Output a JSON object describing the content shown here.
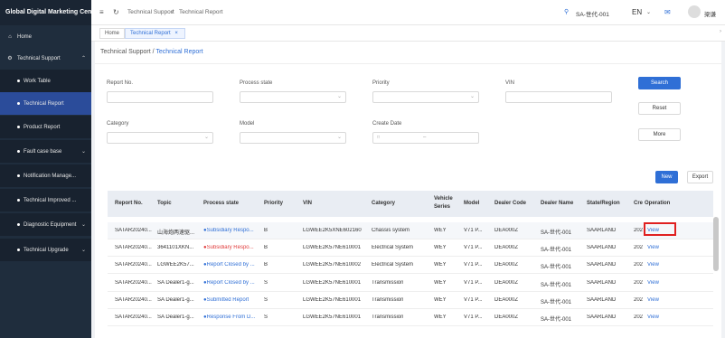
{
  "app": {
    "title": "Global Digital Marketing Center"
  },
  "sidebar": {
    "items": [
      {
        "label": "Home",
        "icon": "home-icon",
        "arrow": ""
      },
      {
        "label": "Technical Support",
        "icon": "gear-icon",
        "arrow": "⌃"
      },
      {
        "label": "Work Table",
        "arrow": ""
      },
      {
        "label": "Technical Report",
        "arrow": ""
      },
      {
        "label": "Product Report",
        "arrow": ""
      },
      {
        "label": "Fault case base",
        "arrow": "⌄"
      },
      {
        "label": "Notification Manage...",
        "arrow": ""
      },
      {
        "label": "Technical Improved ...",
        "arrow": ""
      },
      {
        "label": "Diagnostic Equipment",
        "arrow": "⌄"
      },
      {
        "label": "Technical Upgrade",
        "arrow": "⌄"
      }
    ]
  },
  "topbar": {
    "breadcrumb_1": "Technical Support",
    "separator": "/",
    "breadcrumb_2": "Technical Report",
    "account": "SA-世代-001",
    "language": "EN",
    "user": "梁谦"
  },
  "tabs": {
    "home": "Home",
    "active": "Technical Report",
    "close": "×"
  },
  "page": {
    "crumb_1": "Technical Support",
    "crumb_sep": "/",
    "crumb_2": "Technical Report"
  },
  "filters": {
    "report_no": "Report No.",
    "process_state": "Process state",
    "priority": "Priority",
    "vin": "VIN",
    "category": "Category",
    "model": "Model",
    "create_date": "Create Date",
    "date_sep": "–"
  },
  "buttons": {
    "search": "Search",
    "reset": "Reset",
    "more": "More",
    "new": "New",
    "export": "Export"
  },
  "table": {
    "headers": [
      "Report No.",
      "Topic",
      "Process state",
      "Priority",
      "VIN",
      "Category",
      "Vehicle Series",
      "Model",
      "Dealer Code",
      "Dealer Name",
      "State/Region",
      "Cre",
      "Operation"
    ],
    "header_vehicle_1": "Vehicle",
    "header_vehicle_2": "Series",
    "rows": [
      {
        "report": "SATAR20240...",
        "topic": "山海炮两速驱...",
        "state": "●Subsidiary Respo...",
        "state_color": "blue",
        "priority": "B",
        "vin": "LGWEE2K5XNE602160",
        "category": "Chassis system",
        "series": "WEY",
        "model": "V71 P...",
        "dealer_code": "DEA000Z",
        "dealer_name": "SA-世代-001",
        "region": "SAARLAND",
        "cre": "202",
        "op": "View"
      },
      {
        "report": "SATAR20240...",
        "topic": "3641101XKN...",
        "state": "●Subsidiary Respo...",
        "state_color": "red",
        "priority": "B",
        "vin": "LGWEE2K57NE610001",
        "category": "Electrical System",
        "series": "WEY",
        "model": "V71 P...",
        "dealer_code": "DEA000Z",
        "dealer_name": "SA-世代-001",
        "region": "SAARLAND",
        "cre": "202",
        "op": "View"
      },
      {
        "report": "SATAR20240...",
        "topic": "LGWEE2K57...",
        "state": "●Report Closed by ...",
        "state_color": "blue",
        "priority": "B",
        "vin": "LGWEE2K57NE610002",
        "category": "Electrical System",
        "series": "WEY",
        "model": "V71 P...",
        "dealer_code": "DEA000Z",
        "dealer_name": "SA-世代-001",
        "region": "SAARLAND",
        "cre": "202",
        "op": "View"
      },
      {
        "report": "SATAR20240...",
        "topic": "SA Dealer1-g...",
        "state": "●Report Closed by ...",
        "state_color": "blue",
        "priority": "S",
        "vin": "LGWEE2K57NE610001",
        "category": "Transmission",
        "series": "WEY",
        "model": "V71 P...",
        "dealer_code": "DEA000Z",
        "dealer_name": "SA-世代-001",
        "region": "SAARLAND",
        "cre": "202",
        "op": "View"
      },
      {
        "report": "SATAR20240...",
        "topic": "SA Dealer1-g...",
        "state": "●Submitted Report",
        "state_color": "blue",
        "priority": "S",
        "vin": "LGWEE2K57NE610001",
        "category": "Transmission",
        "series": "WEY",
        "model": "V71 P...",
        "dealer_code": "DEA000Z",
        "dealer_name": "SA-世代-001",
        "region": "SAARLAND",
        "cre": "202",
        "op": "View"
      },
      {
        "report": "SATAR20240...",
        "topic": "SA Dealer1-g...",
        "state": "●Response From D...",
        "state_color": "blue",
        "priority": "S",
        "vin": "LGWEE2K57NE610001",
        "category": "Transmission",
        "series": "WEY",
        "model": "V71 P...",
        "dealer_code": "DEA000Z",
        "dealer_name": "SA-世代-001",
        "region": "SAARLAND",
        "cre": "202",
        "op": "View"
      }
    ]
  },
  "colors": {
    "sidebar": "#1f2d3d",
    "active": "#2b4c9a",
    "primary": "#2f6fd6",
    "highlight": "#e02020"
  }
}
